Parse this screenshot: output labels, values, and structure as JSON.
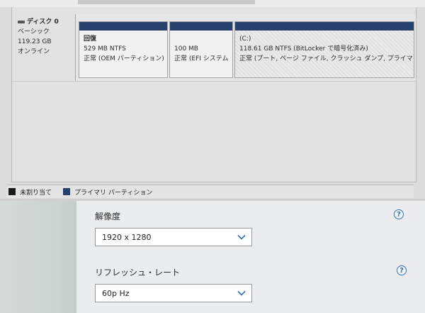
{
  "disk": {
    "name": "ディスク 0",
    "type": "ベーシック",
    "size": "119.23 GB",
    "status": "オンライン"
  },
  "partitions": [
    {
      "title": "回復",
      "size_fs": "529 MB NTFS",
      "status": "正常 (OEM パーティション)"
    },
    {
      "title": "",
      "size_fs": "100 MB",
      "status": "正常 (EFI システム"
    },
    {
      "title": "(C:)",
      "size_fs": "118.61 GB NTFS (BitLocker で暗号化済み)",
      "status": "正常 (ブート, ページ ファイル, クラッシュ ダンプ, プライマリ"
    }
  ],
  "legend": [
    {
      "label": "未割り当て",
      "color": "#1a1a1a"
    },
    {
      "label": "プライマリ パーティション",
      "color": "#27416f"
    }
  ],
  "display": {
    "resolution": {
      "heading": "解像度",
      "value": "1920 x 1280"
    },
    "refresh": {
      "heading": "リフレッシュ・レート",
      "value": "60p Hz"
    },
    "help_glyph": "?"
  },
  "colors": {
    "partition_header": "#27416f",
    "help_accent": "#2f6fb3"
  }
}
